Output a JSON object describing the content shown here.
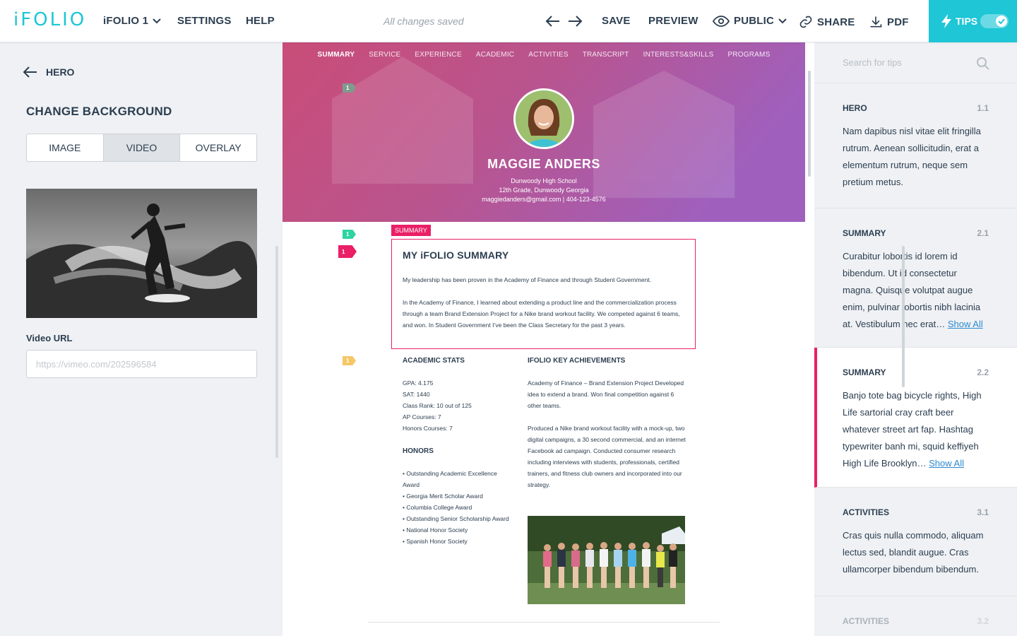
{
  "app": {
    "logo": "iFOLIO",
    "folio_menu": "iFOLIO 1",
    "settings": "SETTINGS",
    "help": "HELP",
    "status": "All changes saved",
    "save": "SAVE",
    "preview": "PREVIEW",
    "visibility": "PUBLIC",
    "share": "SHARE",
    "pdf": "PDF",
    "tips": "TIPS",
    "tips_enabled": true,
    "accent_color": "#1ec6d6",
    "highlight_color": "#ea1f66"
  },
  "left_panel": {
    "back_label": "HERO",
    "title": "CHANGE BACKGROUND",
    "segments": [
      "IMAGE",
      "VIDEO",
      "OVERLAY"
    ],
    "active_segment": "VIDEO",
    "video_url_label": "Video URL",
    "video_url_placeholder": "https://vimeo.com/202596584",
    "video_url_value": ""
  },
  "hero": {
    "nav": [
      "SUMMARY",
      "SERVICE",
      "EXPERIENCE",
      "ACADEMIC",
      "ACTIVITIES",
      "TRANSCRIPT",
      "INTERESTS&SKILLS",
      "PROGRAMS"
    ],
    "active_nav": "SUMMARY",
    "name": "MAGGIE ANDERS",
    "school": "Dunwoody High School",
    "grade": "12th Grade, Dunwoody Georgia",
    "contact": "maggiedanders@gmail.com  |  404-123-4576"
  },
  "markers": {
    "hero": "1",
    "summary_a": "1",
    "summary_b": "1",
    "stats": "1"
  },
  "summary": {
    "tag": "SUMMARY",
    "title": "MY iFOLIO SUMMARY",
    "p1": "My leadership has been proven in the Academy of Finance and through Student Government.",
    "p2": "In the Academy of Finance, I learned about extending a product line and the commercialization process through a team Brand Extension Project for a Nike brand workout facility. We competed against 6 teams, and won. In Student Government I’ve been the Class Secretary for the past 3 years."
  },
  "stats": {
    "title": "ACADEMIC STATS",
    "items": [
      "GPA: 4.175",
      "SAT: 1440",
      "Class Rank: 10 out of 125",
      "AP Courses: 7",
      "Honors Courses: 7"
    ]
  },
  "honors": {
    "title": "HONORS",
    "items": [
      "• Outstanding Academic Excellence Award",
      "• Georgia Merit Scholar Award",
      "• Columbia College Award",
      "• Outstanding Senior Scholarship Award",
      "• National Honor Society",
      "• Spanish Honor Society"
    ]
  },
  "achievements": {
    "title": "IFOLIO KEY ACHIEVEMENTS",
    "p1": "Academy of Finance – Brand Extension Project Developed idea to extend a brand.  Won final competition against 6 other teams.",
    "p2": "Produced a Nike brand workout facility with a mock-up, two digital campaigns, a 30 second commercial, and an internet Facebook ad campaign. Conducted consumer research including interviews with students, professionals, certified trainers, and fitness club owners and incorporated into our strategy."
  },
  "tips_panel": {
    "search_placeholder": "Search for tips",
    "show_all": "Show All",
    "tips": [
      {
        "title": "HERO",
        "num": "1.1",
        "body": "Nam dapibus nisl vitae elit fringilla rutrum. Aenean sollicitudin, erat a elementum rutrum, neque sem pretium metus."
      },
      {
        "title": "SUMMARY",
        "num": "2.1",
        "body": "Curabitur lobortis id lorem id bibendum. Ut id consectetur magna. Quisque volutpat augue enim, pulvinar lobortis nibh lacinia at. Vestibulum nec erat…"
      },
      {
        "title": "SUMMARY",
        "num": "2.2",
        "body": "Banjo tote bag bicycle rights, High Life sartorial cray craft beer whatever street art fap. Hashtag typewriter banh mi, squid keffiyeh High Life Brooklyn…"
      },
      {
        "title": "ACTIVITIES",
        "num": "3.1",
        "body": "Cras quis nulla commodo, aliquam lectus sed, blandit augue. Cras ullamcorper bibendum bibendum."
      },
      {
        "title": "ACTIVITIES",
        "num": "3.2",
        "body": ""
      }
    ]
  }
}
